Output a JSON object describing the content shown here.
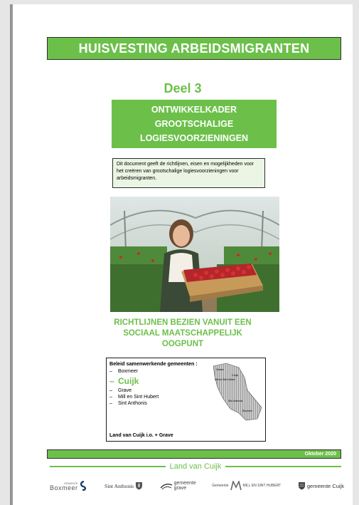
{
  "document": {
    "title": "HUISVESTING ARBEIDSMIGRANTEN",
    "part": "Deel 3",
    "subtitle_lines": [
      "ONTWIKKELKADER",
      "GROOTSCHALIGE",
      "LOGIESVOORZIENINGEN"
    ],
    "intro": "Dit document geeft de richtlijnen, eisen en mogelijkheden  voor het creëren van grootschalige logiesvoorzieningen voor arbeidsmigranten.",
    "guideline_lines": [
      "RICHTLIJNEN BEZIEN VANUIT EEN",
      "SOCIAAL MAATSCHAPPELIJK",
      "OOGPUNT"
    ]
  },
  "map_box": {
    "heading": "Beleid samenwerkende gemeenten :",
    "municipalities": [
      "Boxmeer",
      "Cuijk",
      "Grave",
      "Mill en Sint Hubert",
      "Sint Anthonis"
    ],
    "highlighted": "Cuijk",
    "footer": "Land van Cuijk i.o. + Grave",
    "map_labels": [
      "Grave",
      "Cuijk",
      "Mill en Sint Hubert",
      "Sint Anthonis",
      "Boxmeer"
    ]
  },
  "footer": {
    "date": "Oktober 2020",
    "region": "Land van Cuijk"
  },
  "logos": [
    {
      "name": "gemeente Boxmeer",
      "text": "Boxmeer",
      "small": "GEMEENTE"
    },
    {
      "name": "Sint Anthonis",
      "text": "Sint Anthonis"
    },
    {
      "name": "gemeente Grave",
      "text": "gemeente grave"
    },
    {
      "name": "Mill en Sint Hubert",
      "text": "MILL EN SINT HUBERT",
      "small": "Gemeente"
    },
    {
      "name": "gemeente Cuijk",
      "text": "gemeente Cuijk"
    }
  ],
  "colors": {
    "brand_green": "#6cc04a",
    "box_tint": "#eaf5e3"
  }
}
